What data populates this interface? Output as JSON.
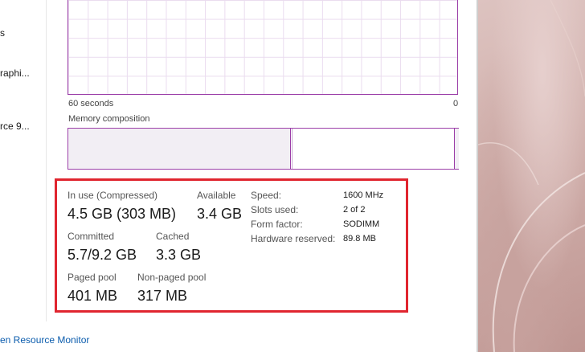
{
  "sidebar": {
    "items": [
      {
        "label": "s"
      },
      {
        "label": "raphi..."
      },
      {
        "label": "rce 9..."
      }
    ]
  },
  "graph": {
    "time_label": "60 seconds",
    "zero_label": "0"
  },
  "composition": {
    "title": "Memory composition"
  },
  "stats": {
    "in_use_label": "In use (Compressed)",
    "in_use_value": "4.5 GB (303 MB)",
    "available_label": "Available",
    "available_value": "3.4 GB",
    "committed_label": "Committed",
    "committed_value": "5.7/9.2 GB",
    "cached_label": "Cached",
    "cached_value": "3.3 GB",
    "paged_pool_label": "Paged pool",
    "paged_pool_value": "401 MB",
    "non_paged_pool_label": "Non-paged pool",
    "non_paged_pool_value": "317 MB"
  },
  "specs": {
    "speed_label": "Speed:",
    "speed_value": "1600 MHz",
    "slots_label": "Slots used:",
    "slots_value": "2 of 2",
    "form_factor_label": "Form factor:",
    "form_factor_value": "SODIMM",
    "hw_reserved_label": "Hardware reserved:",
    "hw_reserved_value": "89.8 MB"
  },
  "footer": {
    "link_label": "en Resource Monitor"
  },
  "colors": {
    "graph_border": "#9b3ea8",
    "highlight": "#e0252f",
    "link": "#0b5cad"
  }
}
